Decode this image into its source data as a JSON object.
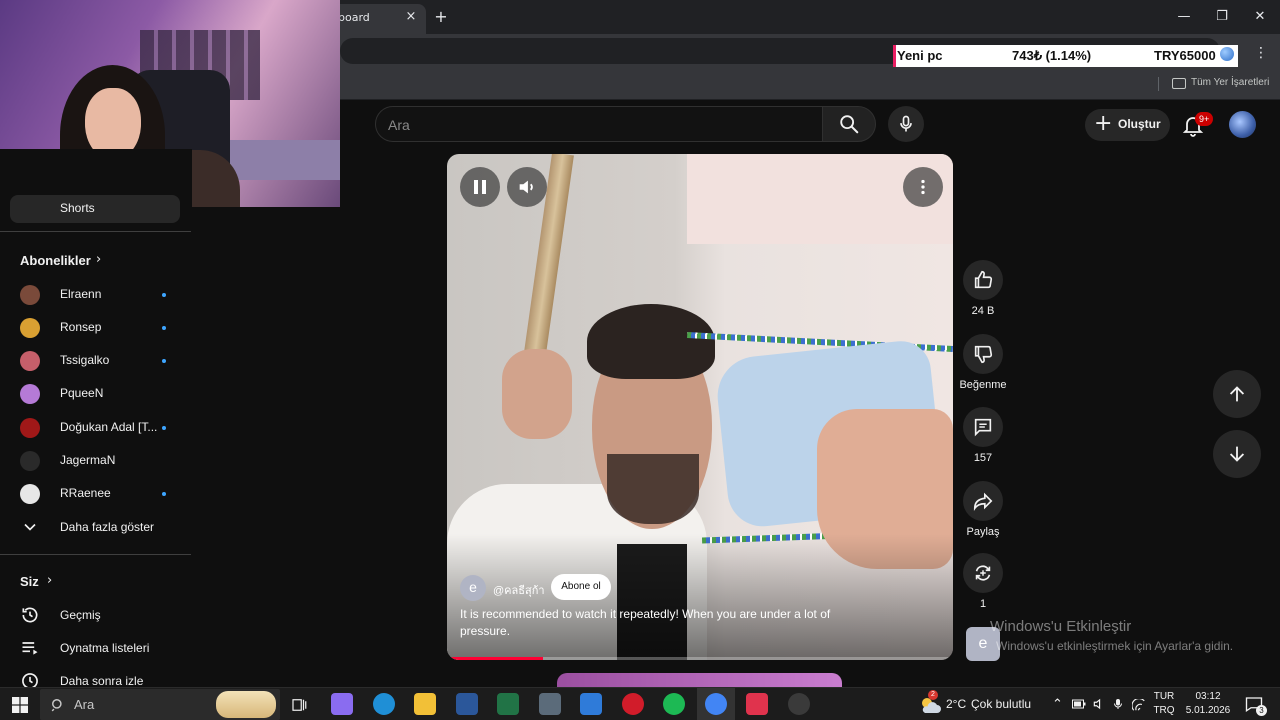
{
  "browser": {
    "tab_title": "board",
    "tab_close": "×",
    "new_tab": "+",
    "minimize": "—",
    "maximize": "❐",
    "close": "✕",
    "menu": "⋮",
    "bookmarks_all": "Tüm Yer İşaretleri"
  },
  "ticker": {
    "label": "Yeni pc",
    "amount": "743₺ (1.14%)",
    "goal": "TRY65000"
  },
  "header": {
    "search_placeholder": "Ara",
    "create_label": "Oluştur",
    "notification_count": "9+"
  },
  "sidebar": {
    "shorts_label": "Shorts",
    "subscriptions_heading": "Abonelikler",
    "subscriptions": [
      {
        "name": "Elraenn",
        "has_new": true,
        "color": "#7a4a3a"
      },
      {
        "name": "Ronsep",
        "has_new": true,
        "color": "#d9a032"
      },
      {
        "name": "Tssigalko",
        "has_new": true,
        "color": "#c65f6a"
      },
      {
        "name": "PqueeN",
        "has_new": false,
        "color": "#b57ad6"
      },
      {
        "name": "Doğukan Adal [T...",
        "has_new": true,
        "color": "#a01818"
      },
      {
        "name": "JagermaN",
        "has_new": false,
        "color": "#2a2a2a"
      },
      {
        "name": "RRaenee",
        "has_new": true,
        "color": "#e6e6e6"
      }
    ],
    "show_more": "Daha fazla göster",
    "you_heading": "Siz",
    "you_items": [
      "Geçmiş",
      "Oynatma listeleri",
      "Daha sonra izle"
    ]
  },
  "video": {
    "channel_initial": "e",
    "channel_handle": "@คลธีสุก้า",
    "subscribe_label": "Abone ol",
    "caption": "It is recommended to watch it repeatedly! When you are under a lot of pressure.",
    "progress": 0.19
  },
  "actions": {
    "likes": "24 B",
    "dislike_label": "Beğenme",
    "comments": "157",
    "share_label": "Paylaş",
    "remix_count": "1"
  },
  "watermark": {
    "title": "Windows'u Etkinleştir",
    "subtitle": "Windows'u etkinleştirmek için Ayarlar'a gidin."
  },
  "taskbar": {
    "search_placeholder": "Ara",
    "weather_temp": "2°C",
    "weather_text": "Çok bulutlu",
    "weather_badge": "2",
    "lang_top": "TUR",
    "lang_bottom": "TRQ",
    "time": "03:12",
    "date": "5.01.2026",
    "notif_count": "3",
    "apps": [
      {
        "name": "copilot",
        "color": "#8a6cf0"
      },
      {
        "name": "edge",
        "color": "#1f8fd6"
      },
      {
        "name": "file-explorer",
        "color": "#f2c037"
      },
      {
        "name": "word",
        "color": "#2b579a"
      },
      {
        "name": "excel",
        "color": "#217346"
      },
      {
        "name": "calculator",
        "color": "#5b6b7a"
      },
      {
        "name": "store",
        "color": "#2f7bd9"
      },
      {
        "name": "opera",
        "color": "#d11c2a"
      },
      {
        "name": "spotify",
        "color": "#1db954"
      },
      {
        "name": "chrome",
        "color": "#4285f4"
      },
      {
        "name": "pinned-red-app",
        "color": "#e0334d"
      },
      {
        "name": "recording-app",
        "color": "#3a3a3a"
      }
    ]
  }
}
